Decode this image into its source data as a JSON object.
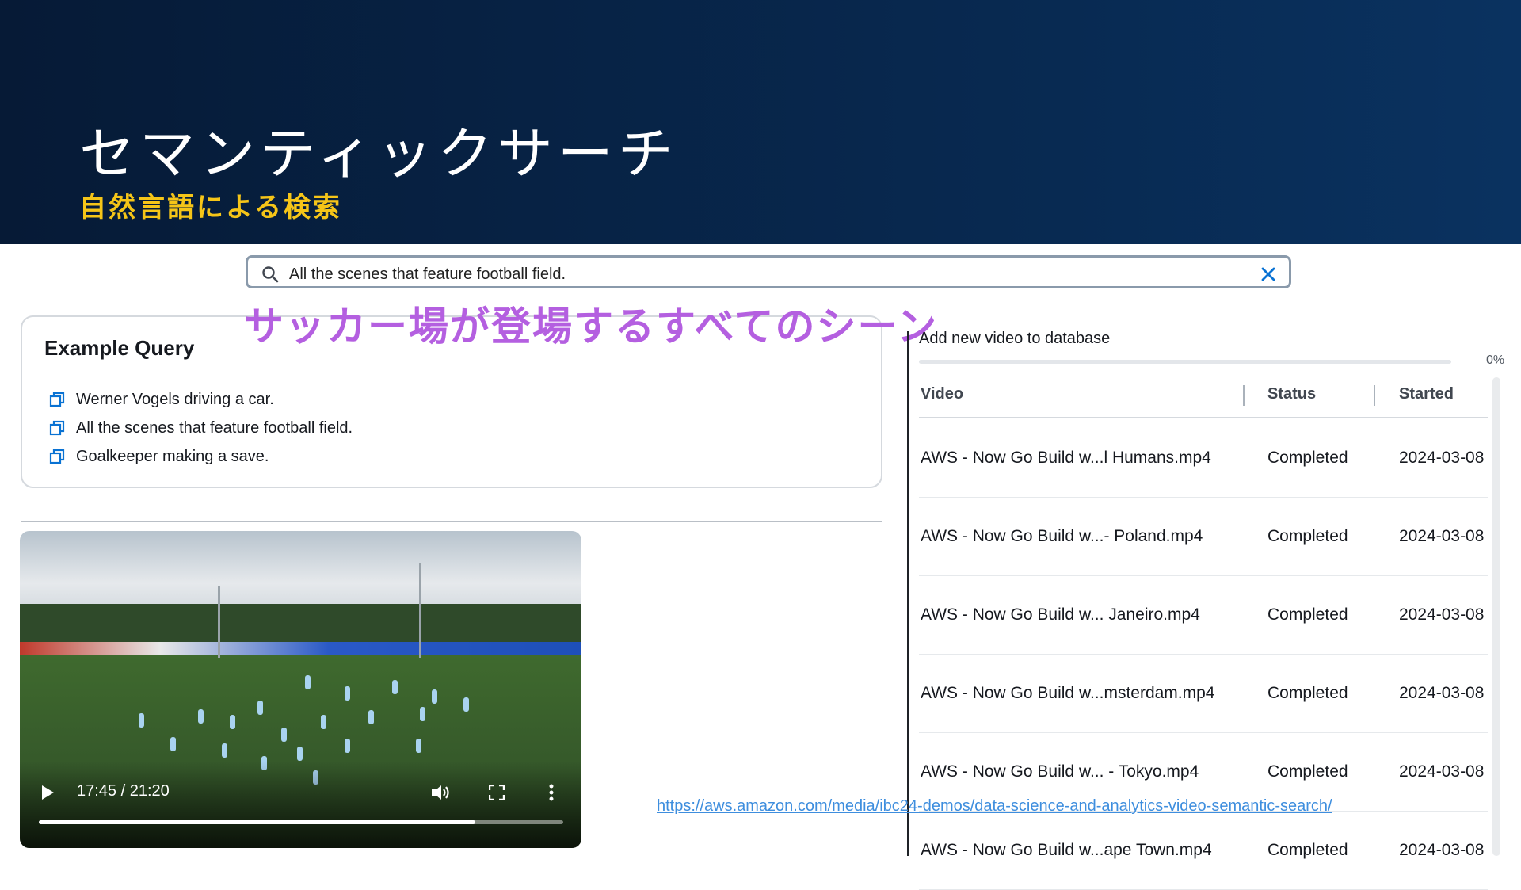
{
  "header": {
    "title": "セマンティックサーチ",
    "subtitle": "自然言語による検索"
  },
  "search": {
    "value": "All the scenes that feature football field.",
    "icon": "search-icon",
    "clear_icon": "close-icon"
  },
  "overlay_caption": "サッカー場が登場するすべてのシーン",
  "example_query": {
    "title": "Example Query",
    "items": [
      "Werner Vogels driving a car.",
      "All the scenes that feature football field.",
      "Goalkeeper making a save."
    ]
  },
  "player": {
    "time": "17:45 / 21:20",
    "progress": 0.832
  },
  "database": {
    "add_label": "Add new video to database",
    "progress_percent": "0%",
    "columns": [
      "Video",
      "Status",
      "Started"
    ],
    "rows": [
      {
        "video": "AWS - Now Go Build w...l Humans.mp4",
        "status": "Completed",
        "started": "2024-03-08"
      },
      {
        "video": "AWS - Now Go Build w...- Poland.mp4",
        "status": "Completed",
        "started": "2024-03-08"
      },
      {
        "video": "AWS - Now Go Build w... Janeiro.mp4",
        "status": "Completed",
        "started": "2024-03-08"
      },
      {
        "video": "AWS - Now Go Build w...msterdam.mp4",
        "status": "Completed",
        "started": "2024-03-08"
      },
      {
        "video": "AWS - Now Go Build w... - Tokyo.mp4",
        "status": "Completed",
        "started": "2024-03-08"
      },
      {
        "video": "AWS - Now Go Build w...ape Town.mp4",
        "status": "Completed",
        "started": "2024-03-08"
      }
    ]
  },
  "link_url": "https://aws.amazon.com/media/ibc24-demos/data-science-and-analytics-video-semantic-search/",
  "colors": {
    "header_bg": "#082a52",
    "subtitle": "#f5c518",
    "overlay": "#b45fe0",
    "link": "#3e8ede",
    "icon_blue": "#0972d3"
  }
}
